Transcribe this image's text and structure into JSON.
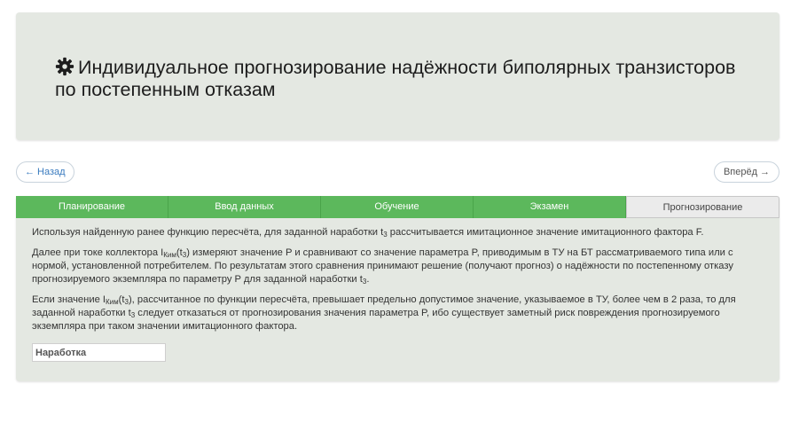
{
  "header": {
    "title": "Индивидуальное прогнозирование надёжности биполярных транзисторов по постепенным отказам",
    "icon": "gear-icon"
  },
  "nav": {
    "back_label": "← Назад",
    "forward_label": "Вперёд →"
  },
  "tabs": [
    {
      "label": "Планирование",
      "active": false
    },
    {
      "label": "Ввод данных",
      "active": false
    },
    {
      "label": "Обучение",
      "active": false
    },
    {
      "label": "Экзамен",
      "active": false
    },
    {
      "label": "Прогнозирование",
      "active": true
    }
  ],
  "content": {
    "p1": {
      "a": "Используя найденную ранее функцию пересчёта, для заданной наработки t",
      "sub": "3",
      "b": " рассчитывается имитационное значение имитационного фактора F."
    },
    "p2": {
      "a": "Далее при токе коллектора I",
      "sub1": "Ким",
      "b": "(t",
      "sub2": "3",
      "c": ") измеряют значение P и сравнивают со значение параметра P, приводимым в ТУ на БТ рассматриваемого типа или с нормой, установленной потребителем. По результатам этого сравнения принимают решение (получают прогноз) о надёжности по постепенному отказу прогнозируемого экземпляра по параметру P для заданной наработки t",
      "sub3": "3",
      "d": "."
    },
    "p3": {
      "a": "Если значение I",
      "sub1": "Ким",
      "b": "(t",
      "sub2": "3",
      "c": "), рассчитанное по функции пересчёта, превышает предельно допустимое значение, указываемое в ТУ, более чем в 2 раза, то для заданной наработки t",
      "sub3": "3",
      "d": " следует отказаться от прогнозирования значения параметра P, ибо существует заметный риск повреждения прогнозируемого экземпляра при таком значении имитационного фактора."
    }
  },
  "input": {
    "placeholder": "Наработка",
    "value": ""
  },
  "colors": {
    "accent_green": "#5cb85c",
    "panel_bg": "#e4e8e2",
    "active_tab_bg": "#ebebeb"
  }
}
